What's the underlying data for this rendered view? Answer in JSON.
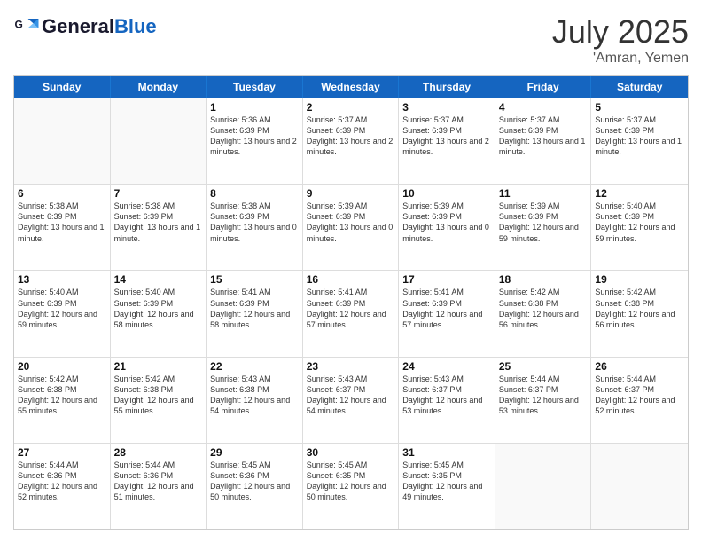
{
  "header": {
    "logo_general": "General",
    "logo_blue": "Blue",
    "month_year": "July 2025",
    "location": "'Amran, Yemen"
  },
  "days_of_week": [
    "Sunday",
    "Monday",
    "Tuesday",
    "Wednesday",
    "Thursday",
    "Friday",
    "Saturday"
  ],
  "weeks": [
    [
      {
        "day": "",
        "info": ""
      },
      {
        "day": "",
        "info": ""
      },
      {
        "day": "1",
        "info": "Sunrise: 5:36 AM\nSunset: 6:39 PM\nDaylight: 13 hours and 2 minutes."
      },
      {
        "day": "2",
        "info": "Sunrise: 5:37 AM\nSunset: 6:39 PM\nDaylight: 13 hours and 2 minutes."
      },
      {
        "day": "3",
        "info": "Sunrise: 5:37 AM\nSunset: 6:39 PM\nDaylight: 13 hours and 2 minutes."
      },
      {
        "day": "4",
        "info": "Sunrise: 5:37 AM\nSunset: 6:39 PM\nDaylight: 13 hours and 1 minute."
      },
      {
        "day": "5",
        "info": "Sunrise: 5:37 AM\nSunset: 6:39 PM\nDaylight: 13 hours and 1 minute."
      }
    ],
    [
      {
        "day": "6",
        "info": "Sunrise: 5:38 AM\nSunset: 6:39 PM\nDaylight: 13 hours and 1 minute."
      },
      {
        "day": "7",
        "info": "Sunrise: 5:38 AM\nSunset: 6:39 PM\nDaylight: 13 hours and 1 minute."
      },
      {
        "day": "8",
        "info": "Sunrise: 5:38 AM\nSunset: 6:39 PM\nDaylight: 13 hours and 0 minutes."
      },
      {
        "day": "9",
        "info": "Sunrise: 5:39 AM\nSunset: 6:39 PM\nDaylight: 13 hours and 0 minutes."
      },
      {
        "day": "10",
        "info": "Sunrise: 5:39 AM\nSunset: 6:39 PM\nDaylight: 13 hours and 0 minutes."
      },
      {
        "day": "11",
        "info": "Sunrise: 5:39 AM\nSunset: 6:39 PM\nDaylight: 12 hours and 59 minutes."
      },
      {
        "day": "12",
        "info": "Sunrise: 5:40 AM\nSunset: 6:39 PM\nDaylight: 12 hours and 59 minutes."
      }
    ],
    [
      {
        "day": "13",
        "info": "Sunrise: 5:40 AM\nSunset: 6:39 PM\nDaylight: 12 hours and 59 minutes."
      },
      {
        "day": "14",
        "info": "Sunrise: 5:40 AM\nSunset: 6:39 PM\nDaylight: 12 hours and 58 minutes."
      },
      {
        "day": "15",
        "info": "Sunrise: 5:41 AM\nSunset: 6:39 PM\nDaylight: 12 hours and 58 minutes."
      },
      {
        "day": "16",
        "info": "Sunrise: 5:41 AM\nSunset: 6:39 PM\nDaylight: 12 hours and 57 minutes."
      },
      {
        "day": "17",
        "info": "Sunrise: 5:41 AM\nSunset: 6:39 PM\nDaylight: 12 hours and 57 minutes."
      },
      {
        "day": "18",
        "info": "Sunrise: 5:42 AM\nSunset: 6:38 PM\nDaylight: 12 hours and 56 minutes."
      },
      {
        "day": "19",
        "info": "Sunrise: 5:42 AM\nSunset: 6:38 PM\nDaylight: 12 hours and 56 minutes."
      }
    ],
    [
      {
        "day": "20",
        "info": "Sunrise: 5:42 AM\nSunset: 6:38 PM\nDaylight: 12 hours and 55 minutes."
      },
      {
        "day": "21",
        "info": "Sunrise: 5:42 AM\nSunset: 6:38 PM\nDaylight: 12 hours and 55 minutes."
      },
      {
        "day": "22",
        "info": "Sunrise: 5:43 AM\nSunset: 6:38 PM\nDaylight: 12 hours and 54 minutes."
      },
      {
        "day": "23",
        "info": "Sunrise: 5:43 AM\nSunset: 6:37 PM\nDaylight: 12 hours and 54 minutes."
      },
      {
        "day": "24",
        "info": "Sunrise: 5:43 AM\nSunset: 6:37 PM\nDaylight: 12 hours and 53 minutes."
      },
      {
        "day": "25",
        "info": "Sunrise: 5:44 AM\nSunset: 6:37 PM\nDaylight: 12 hours and 53 minutes."
      },
      {
        "day": "26",
        "info": "Sunrise: 5:44 AM\nSunset: 6:37 PM\nDaylight: 12 hours and 52 minutes."
      }
    ],
    [
      {
        "day": "27",
        "info": "Sunrise: 5:44 AM\nSunset: 6:36 PM\nDaylight: 12 hours and 52 minutes."
      },
      {
        "day": "28",
        "info": "Sunrise: 5:44 AM\nSunset: 6:36 PM\nDaylight: 12 hours and 51 minutes."
      },
      {
        "day": "29",
        "info": "Sunrise: 5:45 AM\nSunset: 6:36 PM\nDaylight: 12 hours and 50 minutes."
      },
      {
        "day": "30",
        "info": "Sunrise: 5:45 AM\nSunset: 6:35 PM\nDaylight: 12 hours and 50 minutes."
      },
      {
        "day": "31",
        "info": "Sunrise: 5:45 AM\nSunset: 6:35 PM\nDaylight: 12 hours and 49 minutes."
      },
      {
        "day": "",
        "info": ""
      },
      {
        "day": "",
        "info": ""
      }
    ]
  ]
}
